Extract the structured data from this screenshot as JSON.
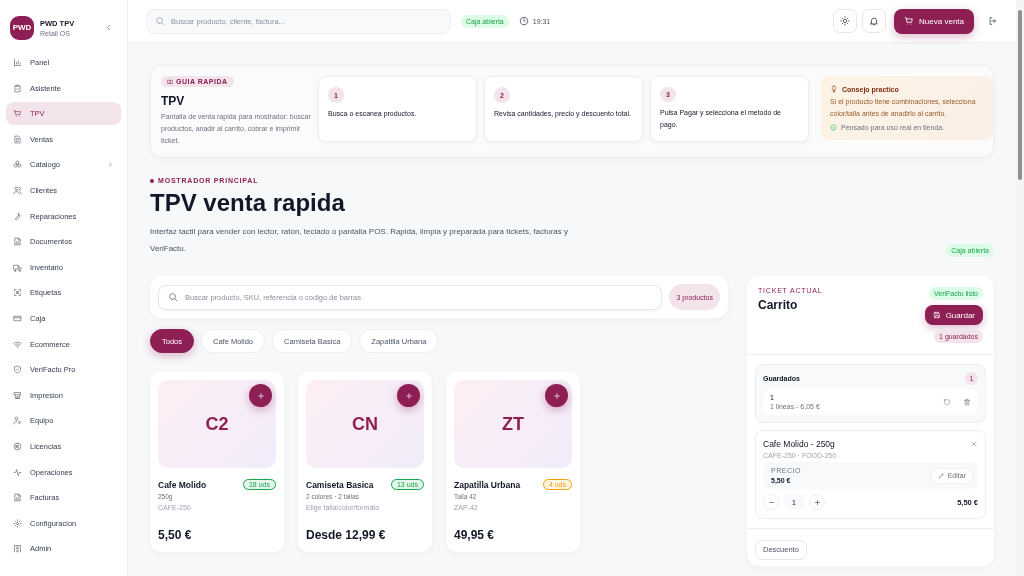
{
  "brand": {
    "logo": "PWD",
    "name": "PWD TPV",
    "subtitle": "Retail OS"
  },
  "sidebar": {
    "items": [
      {
        "label": "Panel",
        "selected": false,
        "kind": "link"
      },
      {
        "label": "Asistente",
        "selected": false,
        "kind": "link"
      },
      {
        "label": "TPV",
        "selected": true,
        "kind": "link"
      },
      {
        "label": "Ventas",
        "selected": false,
        "kind": "link"
      },
      {
        "label": "Catalogo",
        "selected": false,
        "kind": "group"
      },
      {
        "label": "Clientes",
        "selected": false,
        "kind": "link"
      },
      {
        "label": "Reparaciones",
        "selected": false,
        "kind": "link"
      },
      {
        "label": "Documentos",
        "selected": false,
        "kind": "link"
      },
      {
        "label": "Inventario",
        "selected": false,
        "kind": "link"
      },
      {
        "label": "Etiquetas",
        "selected": false,
        "kind": "link"
      },
      {
        "label": "Caja",
        "selected": false,
        "kind": "link"
      },
      {
        "label": "Ecommerce",
        "selected": false,
        "kind": "link"
      },
      {
        "label": "VeriFactu Pro",
        "selected": false,
        "kind": "link"
      },
      {
        "label": "Impresion",
        "selected": false,
        "kind": "link"
      },
      {
        "label": "Equipo",
        "selected": false,
        "kind": "link"
      },
      {
        "label": "Licencias",
        "selected": false,
        "kind": "link"
      },
      {
        "label": "Operaciones",
        "selected": false,
        "kind": "link"
      },
      {
        "label": "Facturas",
        "selected": false,
        "kind": "link"
      },
      {
        "label": "Configuracion",
        "selected": false,
        "kind": "link"
      },
      {
        "label": "Admin",
        "selected": false,
        "kind": "link"
      }
    ]
  },
  "topbar": {
    "search": {
      "placeholder": "Buscar producto, cliente, factura..."
    },
    "status_badge": "Caja abierta",
    "time": "19:31",
    "new_sale_button": "Nueva venta"
  },
  "guide": {
    "tag": "GUIA RAPIDA",
    "title": "TPV",
    "description": "Pantalla de venta rapida para mostrador: buscar productos, anadir al carrito, cobrar e imprimir ticket.",
    "steps": [
      {
        "number": "1",
        "text": "Busca o escanea productos."
      },
      {
        "number": "2",
        "text": "Revisa cantidades, precio y descuento total."
      },
      {
        "number": "3",
        "text": "Pulsa Pagar y selecciona el metodo de pago."
      }
    ],
    "tip": {
      "title": "Consejo practico",
      "text": "Si el producto tiene combinaciones, selecciona color/talla antes de anadirlo al carrito.",
      "note": "Pensado para uso real en tienda."
    }
  },
  "header": {
    "eyebrow": "MOSTRADOR PRINCIPAL",
    "title": "TPV venta rapida",
    "description": "Interfaz tactil para vender con lector, raton, teclado o pantalla POS. Rapida, limpia y preparada para tickets, facturas y VeriFactu.",
    "status_badge": "Caja abierta"
  },
  "product_search": {
    "placeholder": "Buscar producto, SKU, referencia o codigo de barras",
    "count": "3 productos"
  },
  "filters": [
    {
      "label": "Todos",
      "selected": true
    },
    {
      "label": "Cafe Molido",
      "selected": false
    },
    {
      "label": "Camiseta Basica",
      "selected": false
    },
    {
      "label": "Zapatilla Urbana",
      "selected": false
    }
  ],
  "products": [
    {
      "initials": "C2",
      "name": "Cafe Molido",
      "stock": "18 uds",
      "color": "#16a34a",
      "subtitle": "250g",
      "sku": "CAFE-250",
      "price": "5,50 €"
    },
    {
      "initials": "CN",
      "name": "Camiseta Basica",
      "stock": "13 uds",
      "color": "#16a34a",
      "subtitle": "2 colores · 2 tallas",
      "sku": "Elige talla/color/formato",
      "price": "Desde 12,99 €"
    },
    {
      "initials": "ZT",
      "name": "Zapatilla Urbana",
      "stock": "4 uds",
      "color": "#f59e0b",
      "subtitle": "Talla 42",
      "sku": "ZAP-42",
      "price": "49,95 €"
    }
  ],
  "cart": {
    "eyebrow": "TICKET ACTUAL",
    "title": "Carrito",
    "verifactu_badge": "VeriFactu listo",
    "save_button": "Guardar",
    "saved_count": "1 guardados",
    "saved": {
      "title": "Guardados",
      "count": "1",
      "tickets": [
        {
          "name": "1",
          "detail": "1 lineas - 6,05 €"
        }
      ]
    },
    "lines": [
      {
        "name": "Cafe Molido - 250g",
        "codes": "CAFE-250 · FOOD-250",
        "price_label": "PRECIO",
        "price": "5,50 €",
        "edit_button": "Editar",
        "quantity": "1",
        "total": "5,50 €"
      }
    ],
    "discount_button": "Descuento"
  }
}
